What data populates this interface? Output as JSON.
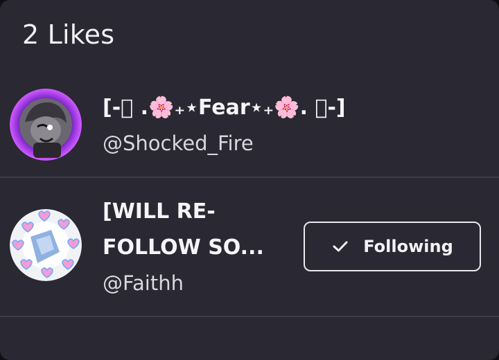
{
  "header": {
    "title": "2 Likes"
  },
  "likes": [
    {
      "name": "[-⃟ .🌸₊⋆Fear⋆₊🌸. ⃟-]",
      "handle": "@Shocked_Fire",
      "avatar_icon": "purple-glow-avatar"
    },
    {
      "name": "[WILL RE-FOLLOW SO...",
      "handle": "@Faithh",
      "avatar_icon": "heart-wreath-avatar",
      "follow_button": {
        "label": "Following",
        "icon": "check-icon"
      }
    }
  ],
  "colors": {
    "background": "#292833",
    "divider": "#3d3c48",
    "text_primary": "#f5f5f7",
    "text_secondary": "#d8d8de",
    "avatar_glow": "#b13cff"
  }
}
